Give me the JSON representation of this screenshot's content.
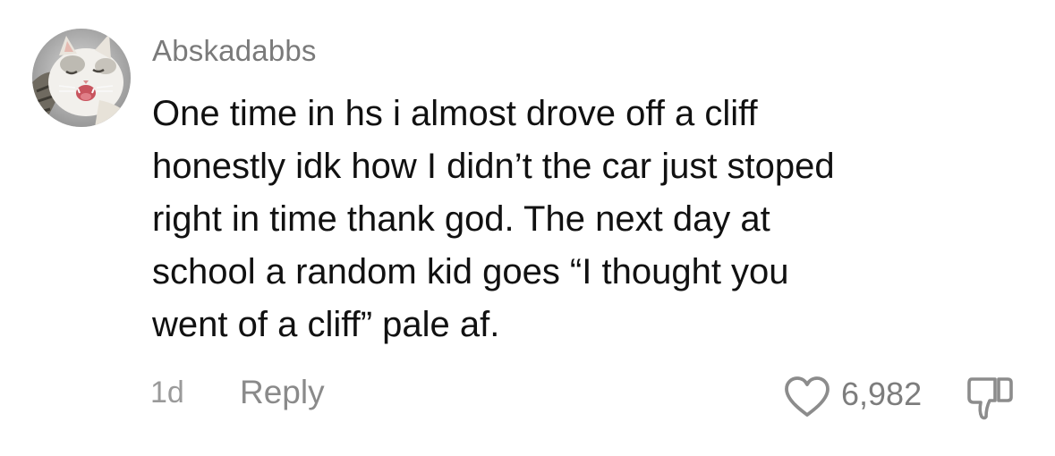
{
  "comment": {
    "username": "Abskadabbs",
    "text_lines": [
      "One time in hs i almost drove off a cliff",
      "honestly idk how I didn’t the car just stoped",
      "right in time thank god. The next day at",
      "school a random kid goes “I thought you",
      "went of a cliff” pale af."
    ],
    "time": "1d",
    "reply_label": "Reply",
    "like_count": "6,982"
  },
  "icons": {
    "avatar": "cat-avatar",
    "like": "heart-outline-icon",
    "dislike": "thumbs-down-outline-icon"
  },
  "colors": {
    "username": "#7a7a7a",
    "body_text": "#111111",
    "meta_text": "#8a8a8a",
    "background": "#ffffff"
  }
}
